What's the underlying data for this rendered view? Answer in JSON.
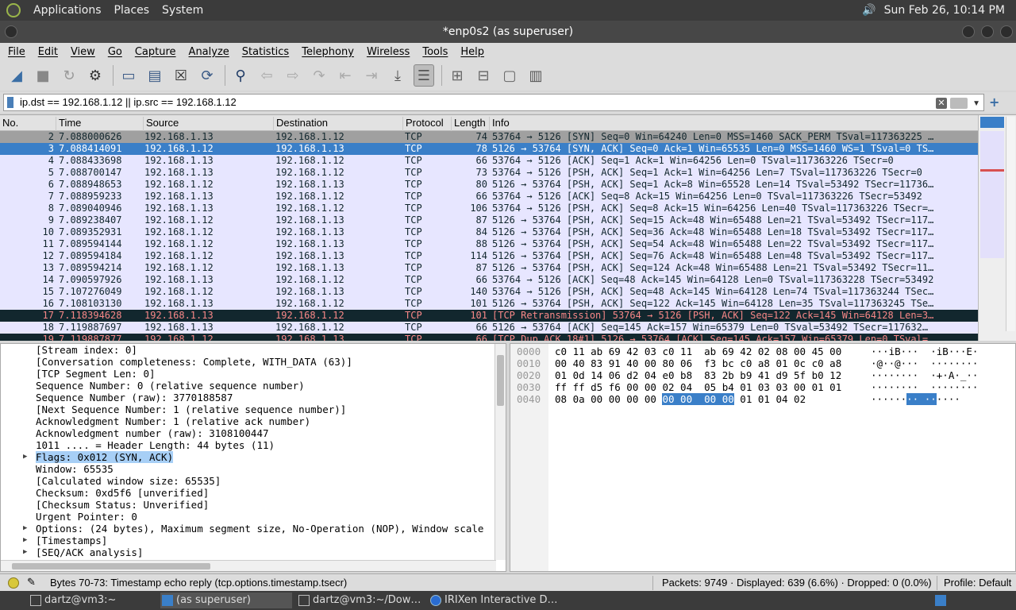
{
  "topbar": {
    "menus": [
      "Applications",
      "Places",
      "System"
    ],
    "clock": "Sun Feb 26, 10:14 PM"
  },
  "window": {
    "title": "*enp0s2 (as superuser)"
  },
  "menubar": [
    "File",
    "Edit",
    "View",
    "Go",
    "Capture",
    "Analyze",
    "Statistics",
    "Telephony",
    "Wireless",
    "Tools",
    "Help"
  ],
  "filter": {
    "value": "ip.dst == 192.168.1.12 || ip.src == 192.168.1.12"
  },
  "columns": [
    "No.",
    "Time",
    "Source",
    "Destination",
    "Protocol",
    "Length",
    "Info"
  ],
  "packets": [
    {
      "no": "2",
      "time": "7.088000626",
      "src": "192.168.1.13",
      "dst": "192.168.1.12",
      "proto": "TCP",
      "len": "74",
      "info": "53764 → 5126 [SYN] Seq=0 Win=64240 Len=0 MSS=1460 SACK_PERM TSval=117363225 …",
      "state": "prev"
    },
    {
      "no": "3",
      "time": "7.088414091",
      "src": "192.168.1.12",
      "dst": "192.168.1.13",
      "proto": "TCP",
      "len": "78",
      "info": "5126 → 53764 [SYN, ACK] Seq=0 Ack=1 Win=65535 Len=0 MSS=1460 WS=1 TSval=0 TS…",
      "state": "sel"
    },
    {
      "no": "4",
      "time": "7.088433698",
      "src": "192.168.1.13",
      "dst": "192.168.1.12",
      "proto": "TCP",
      "len": "66",
      "info": "53764 → 5126 [ACK] Seq=1 Ack=1 Win=64256 Len=0 TSval=117363226 TSecr=0",
      "state": ""
    },
    {
      "no": "5",
      "time": "7.088700147",
      "src": "192.168.1.13",
      "dst": "192.168.1.12",
      "proto": "TCP",
      "len": "73",
      "info": "53764 → 5126 [PSH, ACK] Seq=1 Ack=1 Win=64256 Len=7 TSval=117363226 TSecr=0",
      "state": ""
    },
    {
      "no": "6",
      "time": "7.088948653",
      "src": "192.168.1.12",
      "dst": "192.168.1.13",
      "proto": "TCP",
      "len": "80",
      "info": "5126 → 53764 [PSH, ACK] Seq=1 Ack=8 Win=65528 Len=14 TSval=53492 TSecr=11736…",
      "state": ""
    },
    {
      "no": "7",
      "time": "7.088959233",
      "src": "192.168.1.13",
      "dst": "192.168.1.12",
      "proto": "TCP",
      "len": "66",
      "info": "53764 → 5126 [ACK] Seq=8 Ack=15 Win=64256 Len=0 TSval=117363226 TSecr=53492",
      "state": ""
    },
    {
      "no": "8",
      "time": "7.089040946",
      "src": "192.168.1.13",
      "dst": "192.168.1.12",
      "proto": "TCP",
      "len": "106",
      "info": "53764 → 5126 [PSH, ACK] Seq=8 Ack=15 Win=64256 Len=40 TSval=117363226 TSecr=…",
      "state": ""
    },
    {
      "no": "9",
      "time": "7.089238407",
      "src": "192.168.1.12",
      "dst": "192.168.1.13",
      "proto": "TCP",
      "len": "87",
      "info": "5126 → 53764 [PSH, ACK] Seq=15 Ack=48 Win=65488 Len=21 TSval=53492 TSecr=117…",
      "state": ""
    },
    {
      "no": "10",
      "time": "7.089352931",
      "src": "192.168.1.12",
      "dst": "192.168.1.13",
      "proto": "TCP",
      "len": "84",
      "info": "5126 → 53764 [PSH, ACK] Seq=36 Ack=48 Win=65488 Len=18 TSval=53492 TSecr=117…",
      "state": ""
    },
    {
      "no": "11",
      "time": "7.089594144",
      "src": "192.168.1.12",
      "dst": "192.168.1.13",
      "proto": "TCP",
      "len": "88",
      "info": "5126 → 53764 [PSH, ACK] Seq=54 Ack=48 Win=65488 Len=22 TSval=53492 TSecr=117…",
      "state": ""
    },
    {
      "no": "12",
      "time": "7.089594184",
      "src": "192.168.1.12",
      "dst": "192.168.1.13",
      "proto": "TCP",
      "len": "114",
      "info": "5126 → 53764 [PSH, ACK] Seq=76 Ack=48 Win=65488 Len=48 TSval=53492 TSecr=117…",
      "state": ""
    },
    {
      "no": "13",
      "time": "7.089594214",
      "src": "192.168.1.12",
      "dst": "192.168.1.13",
      "proto": "TCP",
      "len": "87",
      "info": "5126 → 53764 [PSH, ACK] Seq=124 Ack=48 Win=65488 Len=21 TSval=53492 TSecr=11…",
      "state": ""
    },
    {
      "no": "14",
      "time": "7.090597926",
      "src": "192.168.1.13",
      "dst": "192.168.1.12",
      "proto": "TCP",
      "len": "66",
      "info": "53764 → 5126 [ACK] Seq=48 Ack=145 Win=64128 Len=0 TSval=117363228 TSecr=53492",
      "state": ""
    },
    {
      "no": "15",
      "time": "7.107276049",
      "src": "192.168.1.12",
      "dst": "192.168.1.13",
      "proto": "TCP",
      "len": "140",
      "info": "53764 → 5126 [PSH, ACK] Seq=48 Ack=145 Win=64128 Len=74 TSval=117363244 TSec…",
      "state": ""
    },
    {
      "no": "16",
      "time": "7.108103130",
      "src": "192.168.1.13",
      "dst": "192.168.1.12",
      "proto": "TCP",
      "len": "101",
      "info": "5126 → 53764 [PSH, ACK] Seq=122 Ack=145 Win=64128 Len=35 TSval=117363245 TSe…",
      "state": ""
    },
    {
      "no": "17",
      "time": "7.118394628",
      "src": "192.168.1.13",
      "dst": "192.168.1.12",
      "proto": "TCP",
      "len": "101",
      "info": "[TCP Retransmission] 53764 → 5126 [PSH, ACK] Seq=122 Ack=145 Win=64128 Len=3…",
      "state": "bad"
    },
    {
      "no": "18",
      "time": "7.119887697",
      "src": "192.168.1.13",
      "dst": "192.168.1.12",
      "proto": "TCP",
      "len": "66",
      "info": "5126 → 53764 [ACK] Seq=145 Ack=157 Win=65379 Len=0 TSval=53492 TSecr=117632…",
      "state": ""
    },
    {
      "no": "19",
      "time": "7.119887877",
      "src": "192.168.1.12",
      "dst": "192.168.1.13",
      "proto": "TCP",
      "len": "66",
      "info": "[TCP Dup ACK 18#1] 5126 → 53764 [ACK] Seq=145 Ack=157 Win=65379 Len=0 TSval=…",
      "state": "bad"
    }
  ],
  "details": [
    {
      "text": "[Stream index: 0]",
      "expand": ""
    },
    {
      "text": "[Conversation completeness: Complete, WITH_DATA (63)]",
      "expand": ""
    },
    {
      "text": "[TCP Segment Len: 0]",
      "expand": ""
    },
    {
      "text": "Sequence Number: 0    (relative sequence number)",
      "expand": ""
    },
    {
      "text": "Sequence Number (raw): 3770188587",
      "expand": ""
    },
    {
      "text": "[Next Sequence Number: 1    (relative sequence number)]",
      "expand": ""
    },
    {
      "text": "Acknowledgment Number: 1    (relative ack number)",
      "expand": ""
    },
    {
      "text": "Acknowledgment number (raw): 3108100447",
      "expand": ""
    },
    {
      "text": "1011 .... = Header Length: 44 bytes (11)",
      "expand": ""
    },
    {
      "text": "Flags: 0x012 (SYN, ACK)",
      "expand": "▶",
      "sel": true
    },
    {
      "text": "Window: 65535",
      "expand": ""
    },
    {
      "text": "[Calculated window size: 65535]",
      "expand": ""
    },
    {
      "text": "Checksum: 0xd5f6 [unverified]",
      "expand": ""
    },
    {
      "text": "[Checksum Status: Unverified]",
      "expand": ""
    },
    {
      "text": "Urgent Pointer: 0",
      "expand": ""
    },
    {
      "text": "Options: (24 bytes), Maximum segment size, No-Operation (NOP), Window scale",
      "expand": "▶"
    },
    {
      "text": "[Timestamps]",
      "expand": "▶"
    },
    {
      "text": "[SEQ/ACK analysis]",
      "expand": "▶"
    }
  ],
  "bytes": [
    {
      "off": "0000",
      "hex": "c0 11 ab 69 42 03 c0 11  ab 69 42 02 08 00 45 00",
      "ascii": "···iB···  ·iB···E·"
    },
    {
      "off": "0010",
      "hex": "00 40 83 91 40 00 80 06  f3 bc c0 a8 01 0c c0 a8",
      "ascii": "·@··@···  ········"
    },
    {
      "off": "0020",
      "hex": "01 0d 14 06 d2 04 e0 b8  83 2b b9 41 d9 5f b0 12",
      "ascii": "········  ·+·A·_··"
    },
    {
      "off": "0030",
      "hex": "ff ff d5 f6 00 00 02 04  05 b4 01 03 03 00 01 01",
      "ascii": "········  ········"
    },
    {
      "off": "0040",
      "hex_pre": "08 0a 00 00 00 00 ",
      "hex_hl": "00 00  00 00",
      "hex_post": " 01 01 04 02",
      "ascii_pre": "······",
      "ascii_hl": "·· ··",
      "ascii_post": "····"
    }
  ],
  "status": {
    "message": "Bytes 70-73: Timestamp echo reply (tcp.options.timestamp.tsecr)",
    "stats": "Packets: 9749 · Displayed: 639 (6.6%) · Dropped: 0 (0.0%)",
    "profile": "Profile: Default"
  },
  "taskbar": [
    {
      "label": "dartz@vm3:~",
      "icon": "terminal-icon"
    },
    {
      "label": "(as superuser)",
      "icon": "wireshark-icon",
      "active": true
    },
    {
      "label": "dartz@vm3:~/Dow…",
      "icon": "terminal-icon"
    },
    {
      "label": "IRIXen Interactive D…",
      "icon": "browser-icon"
    }
  ]
}
